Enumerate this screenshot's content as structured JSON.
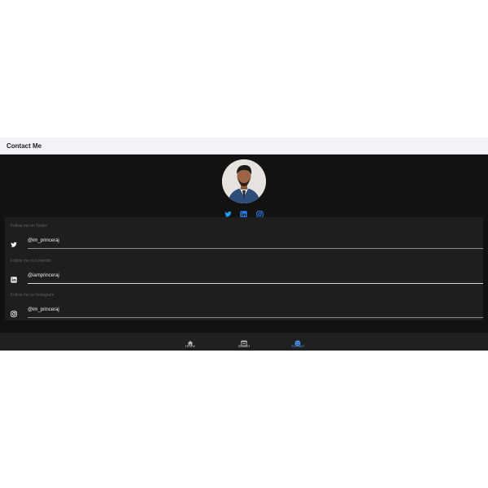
{
  "header": {
    "title": "Contact Me"
  },
  "profile": {
    "avatar_alt": "Profile photo",
    "social_links": [
      {
        "name": "twitter",
        "icon": "twitter-icon",
        "color": "#1da1f2"
      },
      {
        "name": "linkedin",
        "icon": "linkedin-icon",
        "color": "#2d7ff9"
      },
      {
        "name": "instagram",
        "icon": "instagram-icon",
        "color": "#2d7ff9"
      }
    ]
  },
  "contact": {
    "fields": [
      {
        "caption": "Follow me on Twitter",
        "icon": "twitter-icon",
        "value": "@im_princeraj"
      },
      {
        "caption": "Follow me on LinkedIn",
        "icon": "linkedin-icon",
        "value": "@iamprinceraj"
      },
      {
        "caption": "Follow me on Instagram",
        "icon": "instagram-icon",
        "value": "@im_princeraj"
      }
    ]
  },
  "nav": {
    "items": [
      {
        "label": "Home",
        "icon": "home-icon",
        "active": false
      },
      {
        "label": "Basket",
        "icon": "basket-icon",
        "active": false
      },
      {
        "label": "Contact",
        "icon": "contact-icon",
        "active": true
      }
    ]
  },
  "colors": {
    "accent": "#4a90e2",
    "background": "#121212",
    "card": "#1e1e1e",
    "header": "#f1f3f6"
  }
}
